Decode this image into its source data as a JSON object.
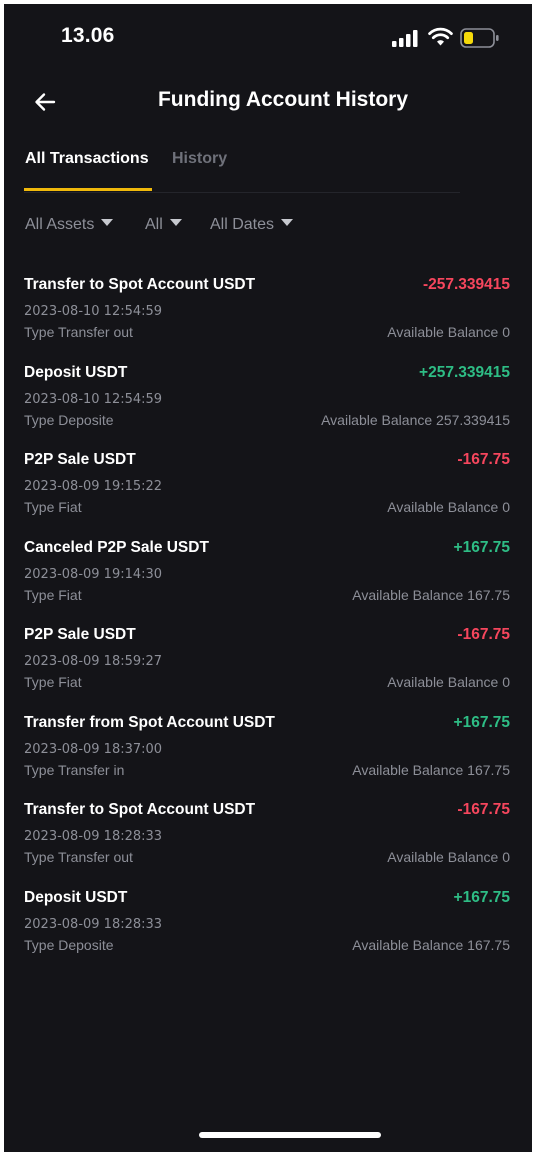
{
  "status_bar": {
    "time": "13.06"
  },
  "header": {
    "title": "Funding Account History"
  },
  "tabs": [
    {
      "label": "All Transactions",
      "active": true
    },
    {
      "label": "History",
      "active": false
    }
  ],
  "filters": [
    {
      "label": "All Assets"
    },
    {
      "label": "All"
    },
    {
      "label": "All Dates"
    }
  ],
  "transactions": [
    {
      "title": "Transfer to Spot Account USDT",
      "amount": "-257.339415",
      "direction": "negative",
      "datetime": "2023-08-10 12:54:59",
      "type": "Type Transfer out",
      "balance": "Available Balance 0"
    },
    {
      "title": "Deposit USDT",
      "amount": "+257.339415",
      "direction": "positive",
      "datetime": "2023-08-10 12:54:59",
      "type": "Type Deposite",
      "balance": "Available Balance 257.339415"
    },
    {
      "title": "P2P Sale USDT",
      "amount": "-167.75",
      "direction": "negative",
      "datetime": "2023-08-09 19:15:22",
      "type": "Type Fiat",
      "balance": "Available Balance 0"
    },
    {
      "title": "Canceled P2P Sale USDT",
      "amount": "+167.75",
      "direction": "positive",
      "datetime": "2023-08-09 19:14:30",
      "type": "Type Fiat",
      "balance": "Available Balance 167.75"
    },
    {
      "title": "P2P Sale USDT",
      "amount": "-167.75",
      "direction": "negative",
      "datetime": "2023-08-09 18:59:27",
      "type": "Type Fiat",
      "balance": "Available Balance 0"
    },
    {
      "title": "Transfer from Spot Account USDT",
      "amount": "+167.75",
      "direction": "positive",
      "datetime": "2023-08-09 18:37:00",
      "type": "Type Transfer in",
      "balance": "Available Balance 167.75"
    },
    {
      "title": "Transfer to Spot Account USDT",
      "amount": "-167.75",
      "direction": "negative",
      "datetime": "2023-08-09 18:28:33",
      "type": "Type Transfer out",
      "balance": "Available Balance 0"
    },
    {
      "title": "Deposit USDT",
      "amount": "+167.75",
      "direction": "positive",
      "datetime": "2023-08-09 18:28:33",
      "type": "Type Deposite",
      "balance": "Available Balance 167.75"
    }
  ],
  "colors": {
    "background": "#141418",
    "accent": "#f0b90b",
    "negative": "#f6465d",
    "positive": "#2ebd85",
    "battery_level": "#f5d90a"
  },
  "icons": {
    "signal": "cellular-signal-icon",
    "wifi": "wifi-icon",
    "battery": "battery-low-icon",
    "back": "back-arrow-icon",
    "caret": "caret-down-icon"
  }
}
